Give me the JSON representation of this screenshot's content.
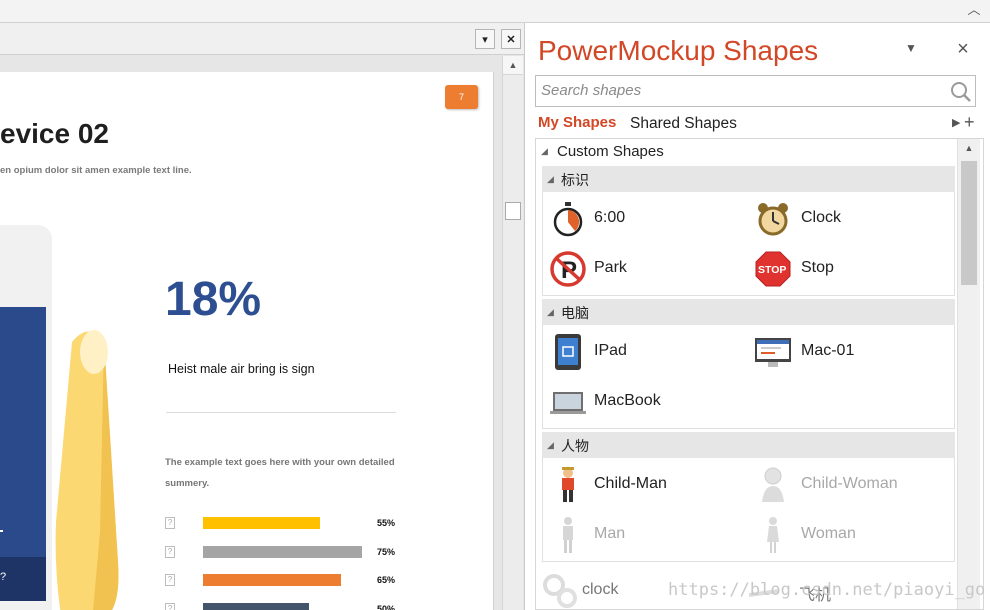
{
  "slide": {
    "number": "7",
    "title": "evice 02",
    "subtitle": "en opium dolor sit amen example text line.",
    "stat_value": "18%",
    "stat_caption": "Heist male air bring is sign",
    "desc_line1": "The example text goes here with your own detailed",
    "desc_line2": "summery.",
    "device_glyph": "?",
    "bars": [
      {
        "label": "55%",
        "value": 55,
        "color": "#ffc000"
      },
      {
        "label": "75%",
        "value": 75,
        "color": "#a5a5a5"
      },
      {
        "label": "65%",
        "value": 65,
        "color": "#ed7d31"
      },
      {
        "label": "50%",
        "value": 50,
        "color": "#44546a"
      }
    ]
  },
  "pane": {
    "title": "PowerMockup Shapes",
    "search_placeholder": "Search shapes",
    "tab_my": "My Shapes",
    "tab_shared": "Shared Shapes",
    "root_group": "Custom Shapes",
    "groups": [
      {
        "label": "标识",
        "items": [
          "6:00",
          "Clock",
          "Park",
          "Stop"
        ]
      },
      {
        "label": "电脑",
        "items": [
          "IPad",
          "Mac-01",
          "MacBook"
        ]
      },
      {
        "label": "人物",
        "items": [
          "Child-Man",
          "Child-Woman",
          "Man",
          "Woman"
        ]
      }
    ],
    "extra_items": [
      "clock",
      "飞机"
    ]
  },
  "watermark": "https://blog.csdn.net/piaoyi_go",
  "colors": {
    "accent": "#d24726",
    "slide_blue": "#2d4f92",
    "badge": "#ed7d31"
  }
}
